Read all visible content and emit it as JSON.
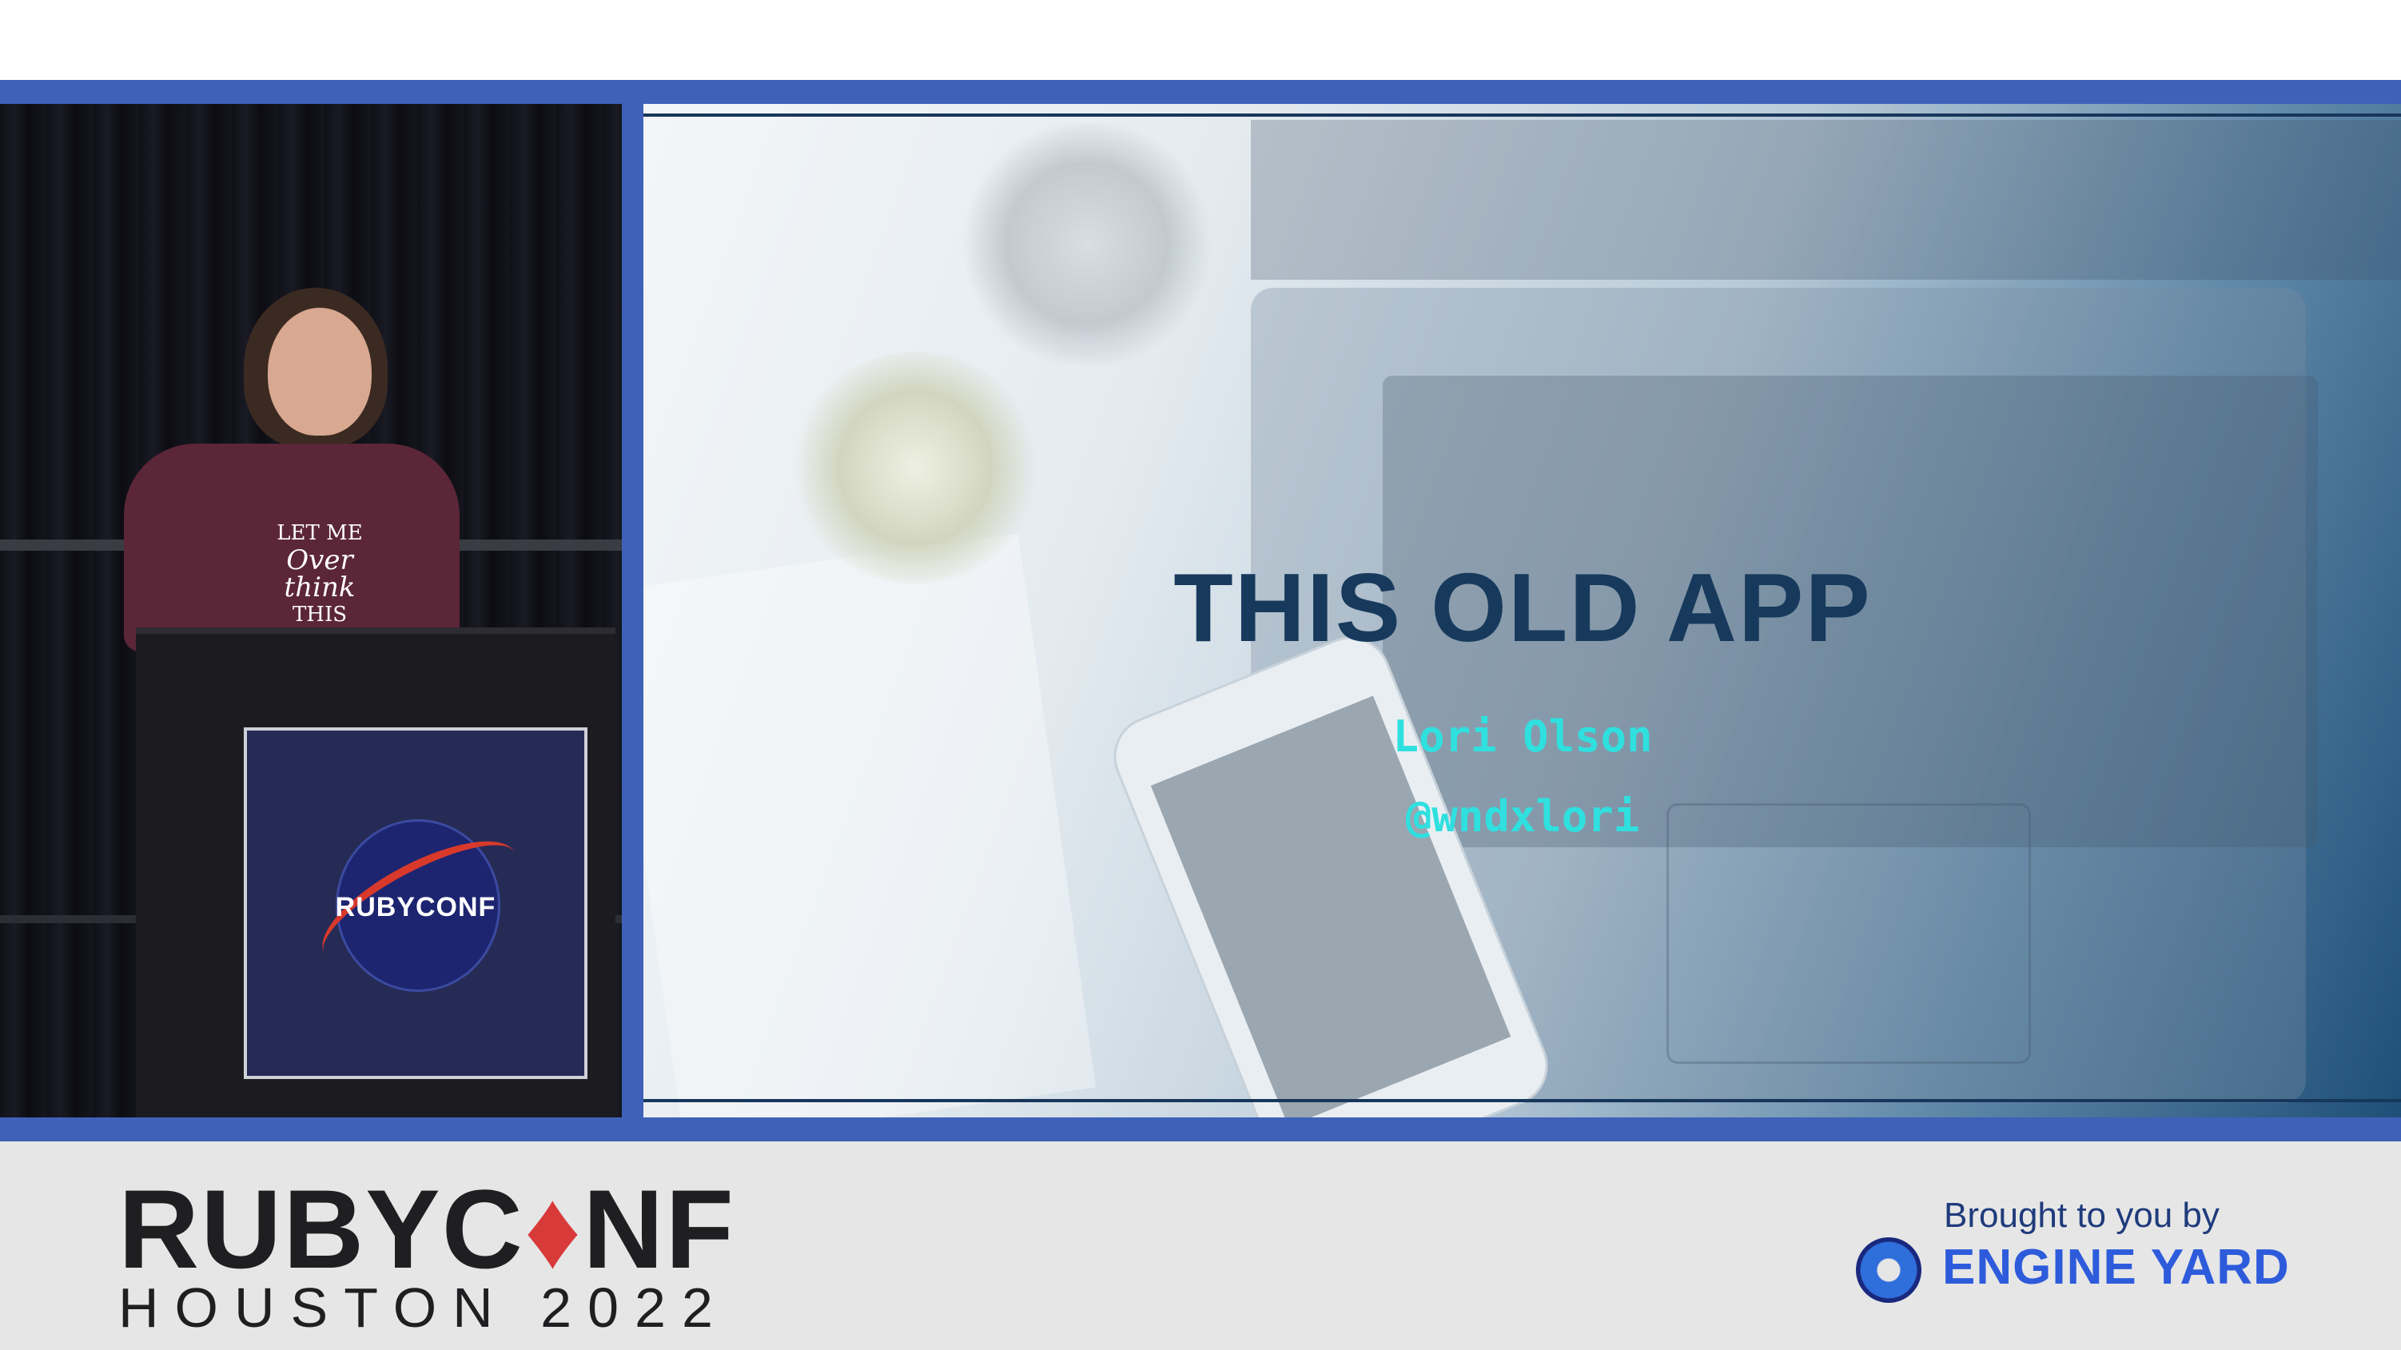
{
  "speaker_panel": {
    "shirt_text": {
      "line1": "LET ME",
      "line2": "Over think",
      "line3": "THIS"
    },
    "podium_sign": "RUBYCONF"
  },
  "slide": {
    "title": "THIS OLD APP",
    "author": "Lori Olson",
    "handle": "@wndxlori",
    "accent_color": "#2fe0df",
    "title_color": "#173a5c"
  },
  "footer": {
    "brand_prefix": "RUBYC",
    "brand_gem": "♦",
    "brand_suffix": "NF",
    "brand_subtitle": "HOUSTON 2022",
    "sponsor_line": "Brought to you by",
    "sponsor_name": "ENGINE YARD",
    "sponsor_color": "#2d5bdb",
    "gem_color": "#d83a3a"
  },
  "frame_color": "#3f61b8"
}
